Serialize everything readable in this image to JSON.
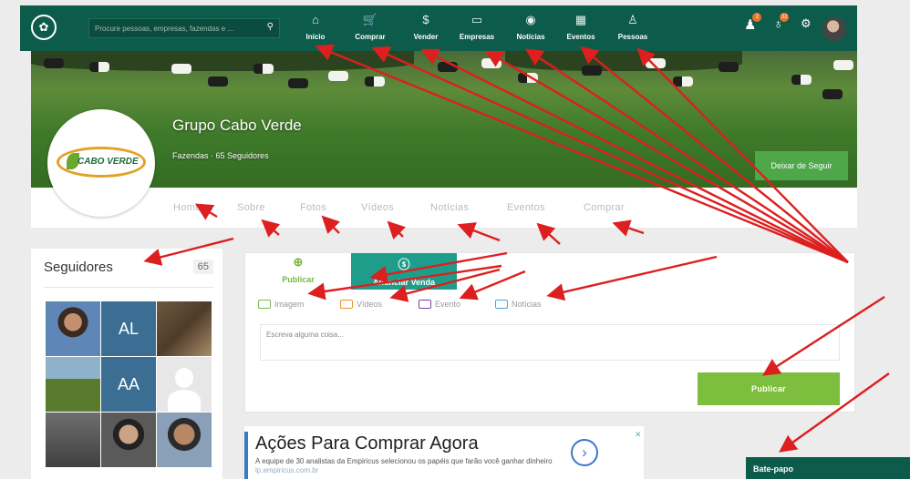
{
  "topbar": {
    "search_placeholder": "Procure pessoas, empresas, fazendas e ...",
    "nav": [
      {
        "label": "Início",
        "icon": "⌂"
      },
      {
        "label": "Comprar",
        "icon": "🛒"
      },
      {
        "label": "Vender",
        "icon": "$"
      },
      {
        "label": "Empresas",
        "icon": "▭"
      },
      {
        "label": "Notícias",
        "icon": "◉"
      },
      {
        "label": "Eventos",
        "icon": "▦"
      },
      {
        "label": "Pessoas",
        "icon": "♙"
      }
    ],
    "badges": {
      "requests": "2",
      "notifications": "32"
    }
  },
  "profile": {
    "name": "Grupo Cabo Verde",
    "meta": "Fazendas · 65 Seguidores",
    "logo_text": "CABO VERDE",
    "unfollow_label": "Deixar de Seguir",
    "tabs": [
      "Home",
      "Sobre",
      "Fotos",
      "Vídeos",
      "Notícias",
      "Eventos",
      "Comprar"
    ]
  },
  "followers": {
    "title": "Seguidores",
    "count": "65",
    "tiles": [
      "",
      "AL",
      "",
      "",
      "AA",
      "",
      "",
      "",
      ""
    ]
  },
  "composer": {
    "tab_publish": "Publicar",
    "tab_sell": "Anunciar Venda",
    "options": [
      {
        "label": "Imagem",
        "color": "#7ab648"
      },
      {
        "label": "Vídeos",
        "color": "#e8922d"
      },
      {
        "label": "Evento",
        "color": "#7b3fa0"
      },
      {
        "label": "Notícias",
        "color": "#4aa3df"
      }
    ],
    "placeholder": "Escreva alguma coisa...",
    "publish_label": "Publicar"
  },
  "ad": {
    "headline": "Ações Para Comprar Agora",
    "body": "A equipe de 30 analistas da Empiricus selecionou os papéis que farão você ganhar dinheiro",
    "link": "lp.empiricus.com.br"
  },
  "chat": {
    "label": "Bate-papo"
  },
  "colors": {
    "brand": "#0d5c4b",
    "accent_green": "#7dbe3e",
    "annotation": "#dd1f1f"
  }
}
